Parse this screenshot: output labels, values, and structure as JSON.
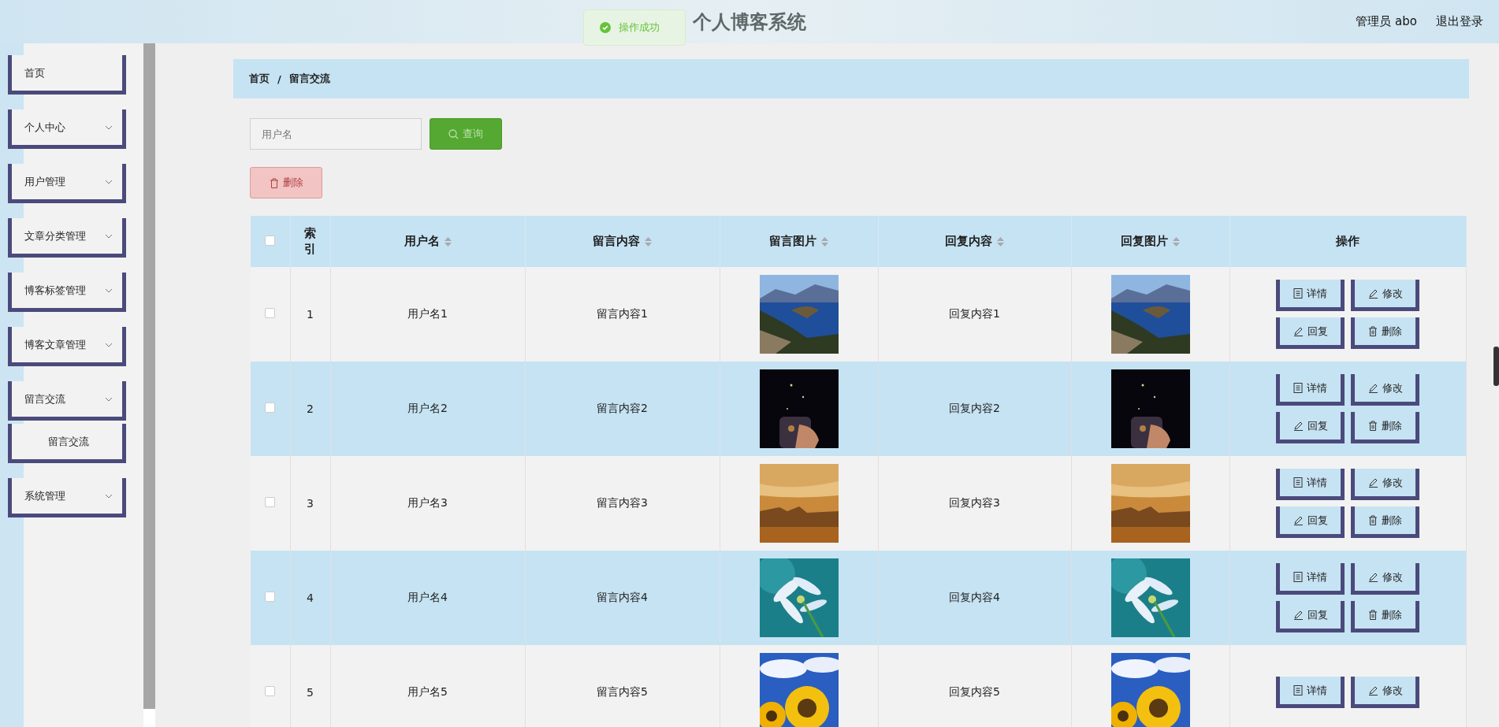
{
  "header": {
    "title": "个人博客系统",
    "user": "管理员 abo",
    "logout": "退出登录"
  },
  "toast": {
    "message": "操作成功"
  },
  "sidebar": {
    "items": [
      {
        "label": "首页",
        "kind": "link"
      },
      {
        "label": "个人中心",
        "kind": "menu"
      },
      {
        "label": "用户管理",
        "kind": "menu"
      },
      {
        "label": "文章分类管理",
        "kind": "menu"
      },
      {
        "label": "博客标签管理",
        "kind": "menu"
      },
      {
        "label": "博客文章管理",
        "kind": "menu"
      },
      {
        "label": "留言交流",
        "kind": "menu",
        "children": [
          {
            "label": "留言交流"
          }
        ]
      },
      {
        "label": "系统管理",
        "kind": "menu"
      }
    ]
  },
  "breadcrumb": {
    "items": [
      "首页",
      "留言交流"
    ],
    "separator": "/"
  },
  "search": {
    "placeholder": "用户名",
    "button": "查询"
  },
  "delete_button": {
    "label": "删除",
    "disabled": true
  },
  "table": {
    "select_all": {
      "checked": false
    },
    "columns": [
      {
        "label": "索引",
        "sortable": false
      },
      {
        "label": "用户名",
        "sortable": true
      },
      {
        "label": "留言内容",
        "sortable": true
      },
      {
        "label": "留言图片",
        "sortable": true
      },
      {
        "label": "回复内容",
        "sortable": true
      },
      {
        "label": "回复图片",
        "sortable": true
      },
      {
        "label": "操作",
        "sortable": false
      }
    ],
    "rows": [
      {
        "checked": false,
        "index": "1",
        "username": "用户名1",
        "content": "留言内容1",
        "reply": "回复内容1",
        "actions": [
          {
            "label": "详情",
            "kind": "detail"
          },
          {
            "label": "修改",
            "kind": "edit"
          },
          {
            "label": "回复",
            "kind": "edit"
          },
          {
            "label": "删除",
            "kind": "delete"
          }
        ]
      },
      {
        "checked": false,
        "index": "2",
        "username": "用户名2",
        "content": "留言内容2",
        "reply": "回复内容2",
        "actions": [
          {
            "label": "详情",
            "kind": "detail"
          },
          {
            "label": "修改",
            "kind": "edit"
          },
          {
            "label": "回复",
            "kind": "edit"
          },
          {
            "label": "删除",
            "kind": "delete"
          }
        ]
      },
      {
        "checked": false,
        "index": "3",
        "username": "用户名3",
        "content": "留言内容3",
        "reply": "回复内容3",
        "actions": [
          {
            "label": "详情",
            "kind": "detail"
          },
          {
            "label": "修改",
            "kind": "edit"
          },
          {
            "label": "回复",
            "kind": "edit"
          },
          {
            "label": "删除",
            "kind": "delete"
          }
        ]
      },
      {
        "checked": false,
        "index": "4",
        "username": "用户名4",
        "content": "留言内容4",
        "reply": "回复内容4",
        "actions": [
          {
            "label": "详情",
            "kind": "detail"
          },
          {
            "label": "修改",
            "kind": "edit"
          },
          {
            "label": "回复",
            "kind": "edit"
          },
          {
            "label": "删除",
            "kind": "delete"
          }
        ]
      },
      {
        "checked": false,
        "index": "5",
        "username": "用户名5",
        "content": "留言内容5",
        "reply": "回复内容5",
        "actions": [
          {
            "label": "详情",
            "kind": "detail"
          },
          {
            "label": "修改",
            "kind": "edit"
          }
        ]
      }
    ]
  }
}
